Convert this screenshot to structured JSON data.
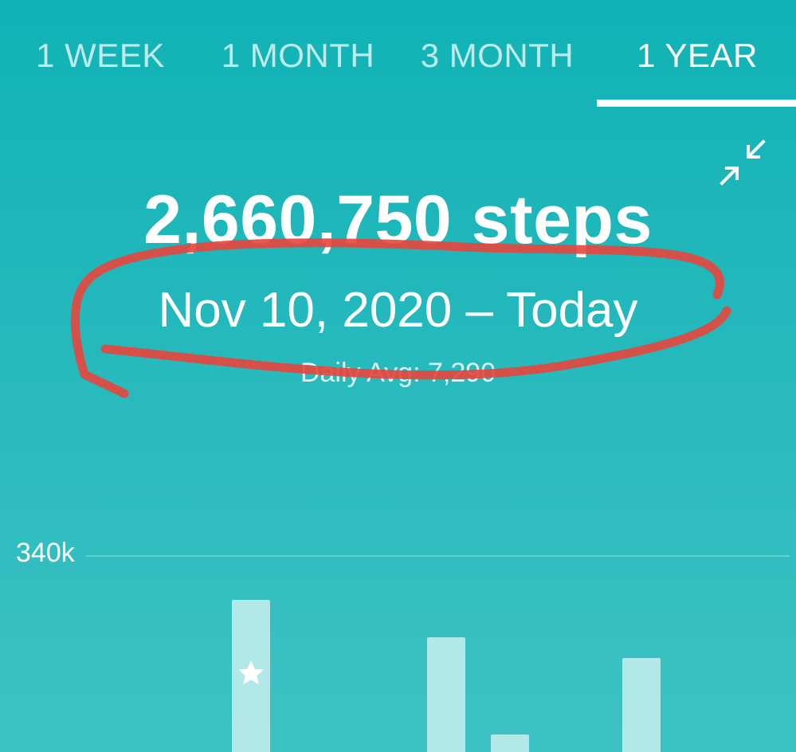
{
  "tabs": [
    {
      "label": "1 WEEK",
      "active": false
    },
    {
      "label": "1 MONTH",
      "active": false
    },
    {
      "label": "3 MONTH",
      "active": false
    },
    {
      "label": "1 YEAR",
      "active": true
    }
  ],
  "summary": {
    "total": "2,660,750 steps",
    "date_range": "Nov 10, 2020 – Today",
    "daily_avg": "Daily Avg: 7,290"
  },
  "icons": {
    "collapse": "collapse-arrows-icon",
    "star": "star-icon"
  },
  "colors": {
    "background_top": "#10b2b5",
    "background_bottom": "#3dc2c3",
    "bar": "#b3e8e9",
    "annotation": "#e8453c"
  },
  "chart_data": {
    "type": "bar",
    "y_tick_labels": [
      "340k"
    ],
    "ylim": [
      0,
      340000
    ],
    "values": [
      264000,
      199000,
      30000,
      163000
    ],
    "highlight_index": 0
  }
}
